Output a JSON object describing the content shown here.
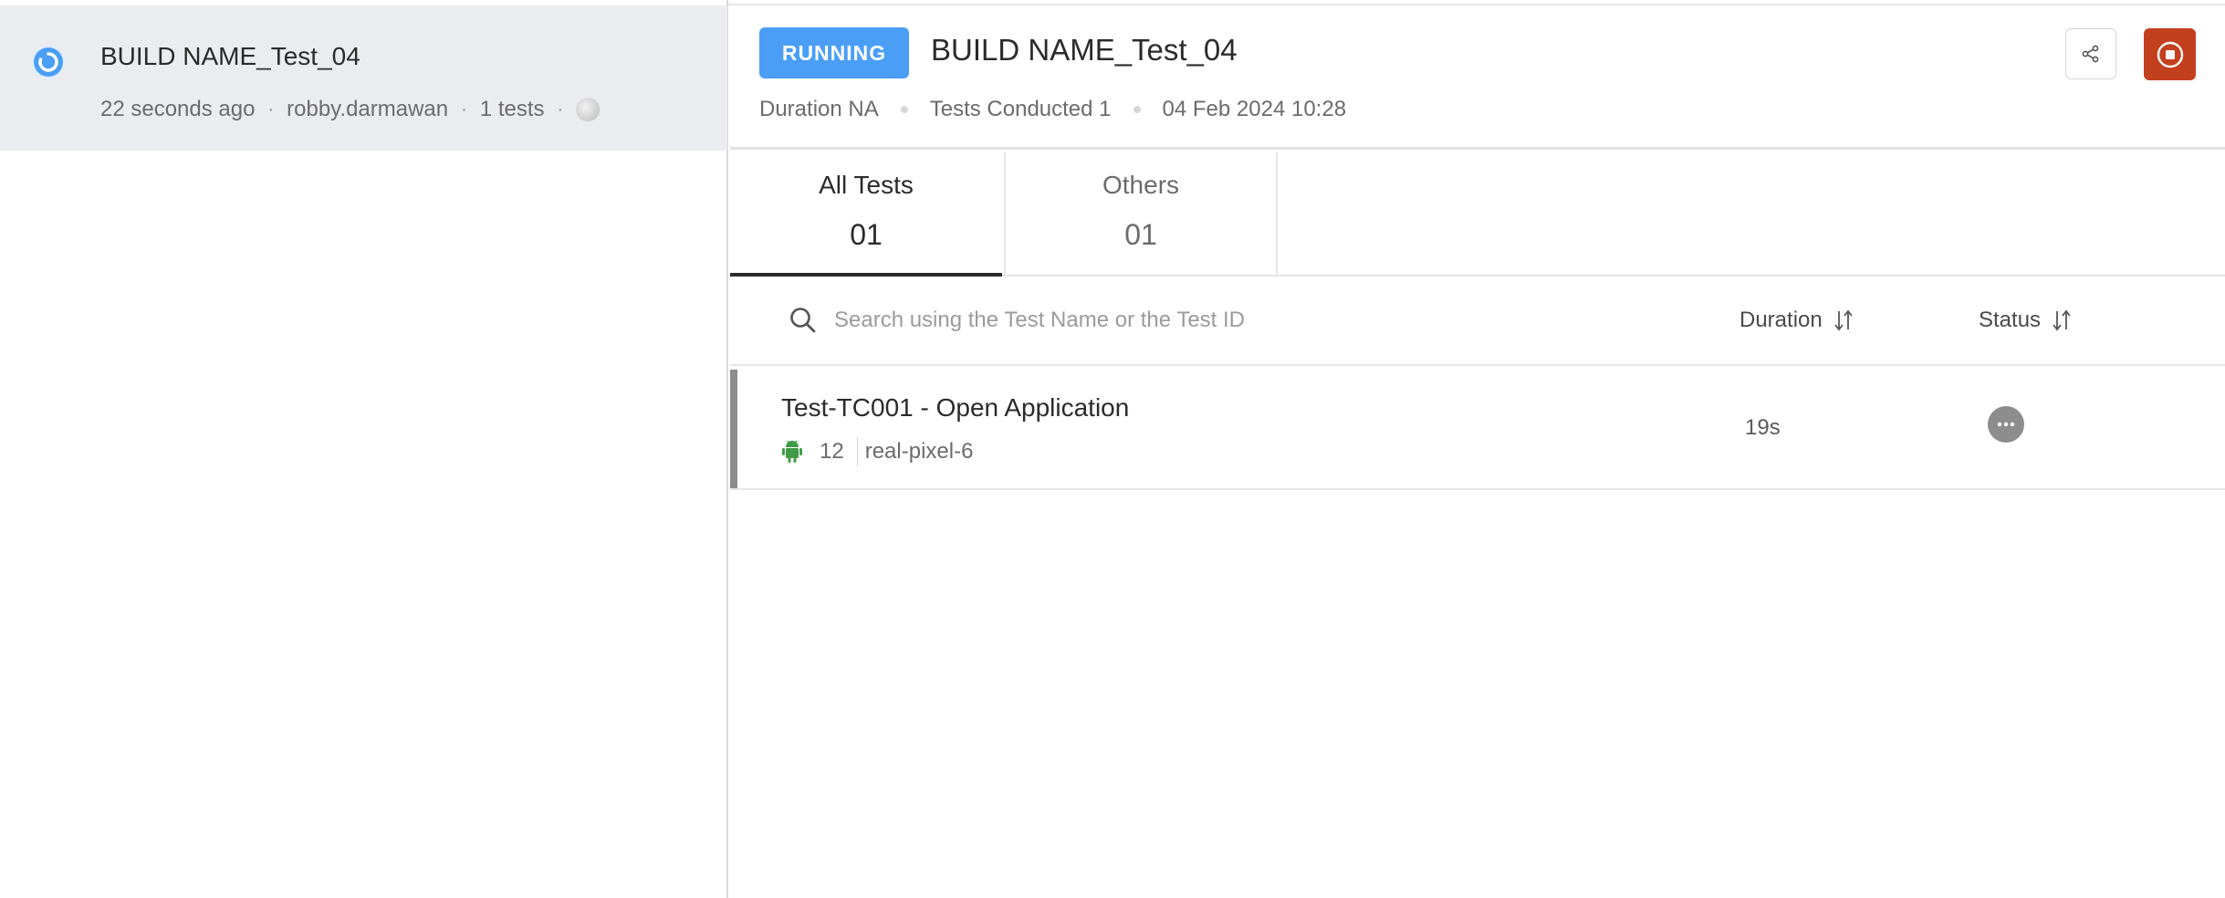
{
  "build_list": {
    "items": [
      {
        "name": "BUILD NAME_Test_04",
        "time_ago": "22 seconds ago",
        "user": "robby.darmawan",
        "tests": "1 tests",
        "dot": "·"
      }
    ]
  },
  "header": {
    "status_badge": "RUNNING",
    "title": "BUILD NAME_Test_04",
    "duration": "Duration NA",
    "tests_conducted": "Tests Conducted 1",
    "date": "04 Feb 2024 10:28"
  },
  "tabs": [
    {
      "label": "All Tests",
      "count": "01"
    },
    {
      "label": "Others",
      "count": "01"
    }
  ],
  "search": {
    "placeholder": "Search using the Test Name or the Test ID",
    "value": ""
  },
  "columns": {
    "duration": "Duration",
    "status": "Status"
  },
  "tests": [
    {
      "name": "Test-TC001 - Open Application",
      "os_version": "12",
      "device": "real-pixel-6",
      "duration": "19s"
    }
  ],
  "colors": {
    "running_badge": "#4a9ef5",
    "stop_button": "#c3401e",
    "android": "#3f9b45",
    "status_pending": "#8d8d8d",
    "selected_card": "#ebecef"
  },
  "icons": {
    "build_status": "spinner-icon",
    "share": "share-icon",
    "stop": "stop-icon",
    "search": "search-icon",
    "sort": "sort-icon",
    "platform": "android-icon",
    "test_status": "more-dots-icon"
  }
}
